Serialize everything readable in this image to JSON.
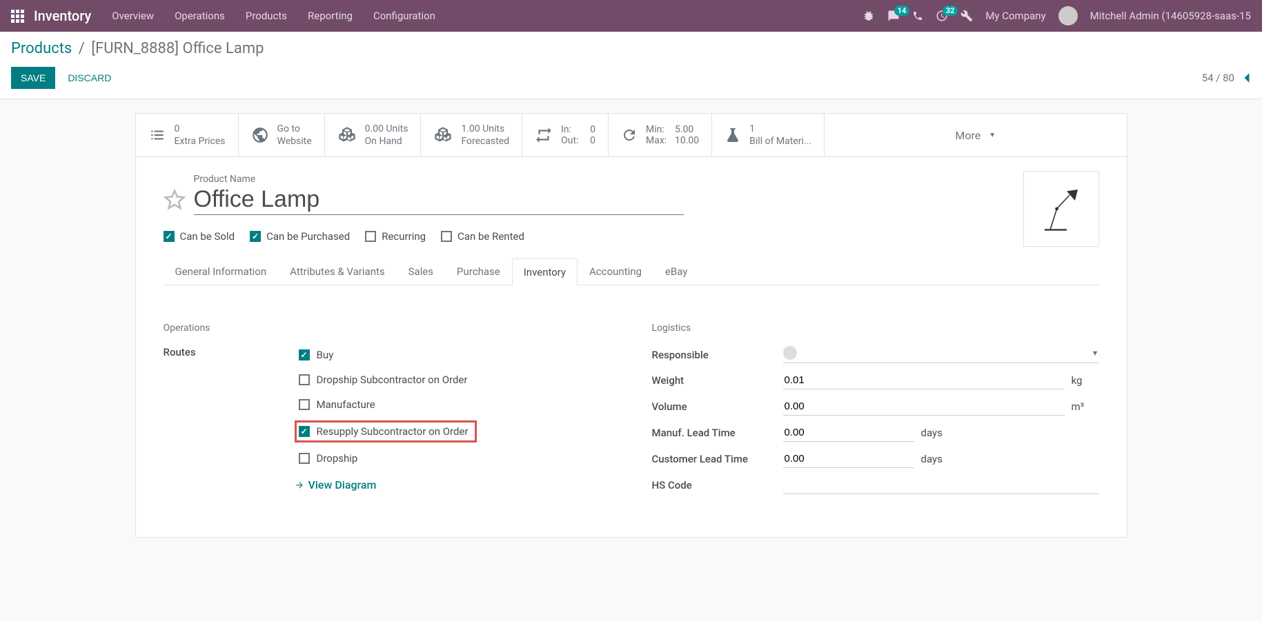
{
  "navbar": {
    "brand": "Inventory",
    "menu": [
      "Overview",
      "Operations",
      "Products",
      "Reporting",
      "Configuration"
    ],
    "messages_badge": "14",
    "activities_badge": "32",
    "company": "My Company",
    "user": "Mitchell Admin (14605928-saas-15"
  },
  "breadcrumb": {
    "parent": "Products",
    "current": "[FURN_8888] Office Lamp"
  },
  "actions": {
    "save": "SAVE",
    "discard": "DISCARD",
    "pager": "54 / 80"
  },
  "stat_buttons": {
    "extra_prices": {
      "top": "0",
      "bot": "Extra Prices"
    },
    "website": {
      "top": "Go to",
      "bot": "Website"
    },
    "on_hand": {
      "top": "0.00 Units",
      "bot": "On Hand"
    },
    "forecasted": {
      "top": "1.00 Units",
      "bot": "Forecasted"
    },
    "inout": {
      "in_label": "In:",
      "in_val": "0",
      "out_label": "Out:",
      "out_val": "0"
    },
    "minmax": {
      "min_label": "Min:",
      "min_val": "5.00",
      "max_label": "Max:",
      "max_val": "10.00"
    },
    "bom": {
      "top": "1",
      "bot": "Bill of Materi..."
    },
    "more": "More"
  },
  "form": {
    "name_label": "Product Name",
    "name_value": "Office Lamp",
    "checks": {
      "sold": "Can be Sold",
      "purchased": "Can be Purchased",
      "recurring": "Recurring",
      "rented": "Can be Rented"
    }
  },
  "tabs": [
    "General Information",
    "Attributes & Variants",
    "Sales",
    "Purchase",
    "Inventory",
    "Accounting",
    "eBay"
  ],
  "inventory_tab": {
    "operations_title": "Operations",
    "logistics_title": "Logistics",
    "routes_label": "Routes",
    "routes": {
      "buy": "Buy",
      "dropship_sub": "Dropship Subcontractor on Order",
      "manufacture": "Manufacture",
      "resupply_sub": "Resupply Subcontractor on Order",
      "dropship": "Dropship"
    },
    "view_diagram": "View Diagram",
    "logistics": {
      "responsible_label": "Responsible",
      "weight_label": "Weight",
      "weight_value": "0.01",
      "weight_unit": "kg",
      "volume_label": "Volume",
      "volume_value": "0.00",
      "volume_unit": "m³",
      "manuf_label": "Manuf. Lead Time",
      "manuf_value": "0.00",
      "manuf_unit": "days",
      "customer_label": "Customer Lead Time",
      "customer_value": "0.00",
      "customer_unit": "days",
      "hs_label": "HS Code"
    }
  }
}
